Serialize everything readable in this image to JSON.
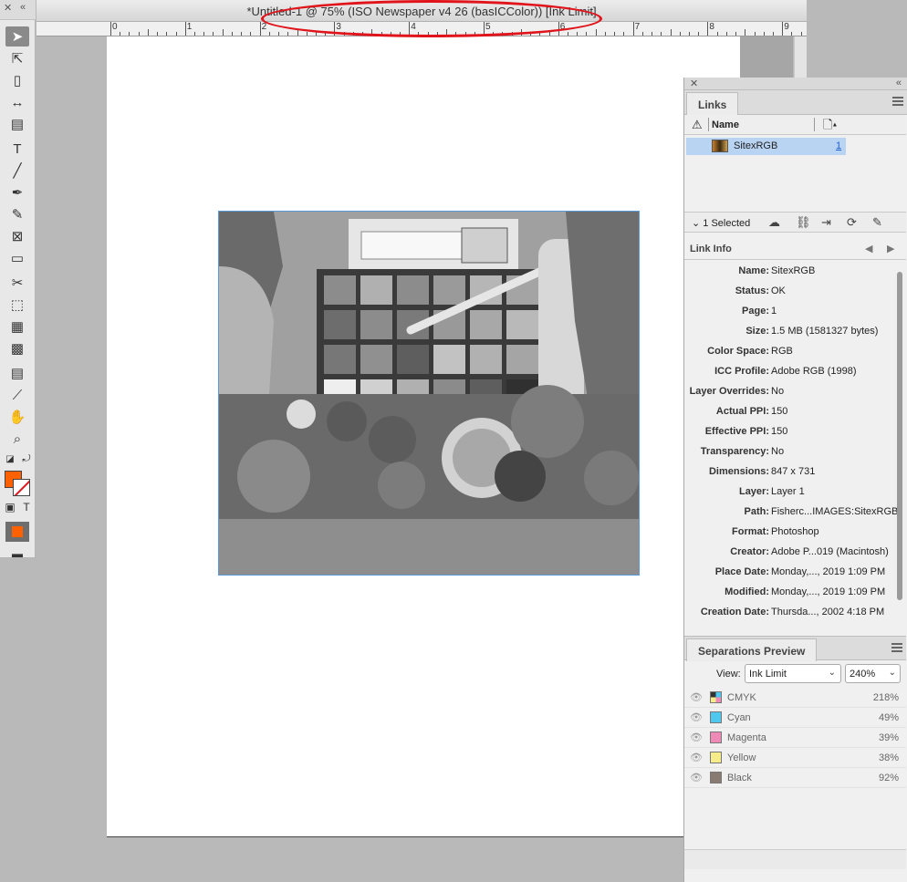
{
  "document": {
    "title": "*Untitled-1 @ 75% (ISO Newspaper v4 26 (basICColor)) [Ink Limit]",
    "ruler_numbers": [
      "0",
      "1",
      "2",
      "3",
      "4",
      "5",
      "6",
      "7",
      "8",
      "9"
    ]
  },
  "tools": {
    "items": [
      {
        "name": "selection-tool",
        "glyph": "➤"
      },
      {
        "name": "direct-selection-tool",
        "glyph": "⇱"
      },
      {
        "name": "page-tool",
        "glyph": "▯"
      },
      {
        "name": "gap-tool",
        "glyph": "↔"
      },
      {
        "name": "content-collector-tool",
        "glyph": "▤"
      },
      {
        "name": "type-tool",
        "glyph": "T"
      },
      {
        "name": "line-tool",
        "glyph": "╱"
      },
      {
        "name": "pen-tool",
        "glyph": "✒"
      },
      {
        "name": "pencil-tool",
        "glyph": "✎"
      },
      {
        "name": "rectangle-frame-tool",
        "glyph": "⊠"
      },
      {
        "name": "rectangle-tool",
        "glyph": "▭"
      },
      {
        "name": "scissors-tool",
        "glyph": "✂"
      },
      {
        "name": "free-transform-tool",
        "glyph": "⬚"
      },
      {
        "name": "gradient-swatch-tool",
        "glyph": "▦"
      },
      {
        "name": "gradient-feather-tool",
        "glyph": "▩"
      },
      {
        "name": "note-tool",
        "glyph": "▤"
      },
      {
        "name": "eyedropper-tool",
        "glyph": "⟋"
      },
      {
        "name": "hand-tool",
        "glyph": "✋"
      },
      {
        "name": "zoom-tool",
        "glyph": "⌕"
      }
    ],
    "colors": {
      "fill": "#ff6000",
      "stroke": "none"
    }
  },
  "links_panel": {
    "tab_label": "Links",
    "column_name": "Name",
    "items": [
      {
        "name": "SitexRGB",
        "page": "1"
      }
    ],
    "selected_text": "1 Selected"
  },
  "link_info": {
    "title": "Link Info",
    "rows": [
      {
        "label": "Name:",
        "value": "SitexRGB"
      },
      {
        "label": "Status:",
        "value": "OK"
      },
      {
        "label": "Page:",
        "value": "1"
      },
      {
        "label": "Size:",
        "value": "1.5 MB (1581327 bytes)"
      },
      {
        "label": "Color Space:",
        "value": "RGB"
      },
      {
        "label": "ICC Profile:",
        "value": "Adobe RGB (1998)"
      },
      {
        "label": "Layer Overrides:",
        "value": "No"
      },
      {
        "label": "Actual PPI:",
        "value": "150"
      },
      {
        "label": "Effective PPI:",
        "value": "150"
      },
      {
        "label": "Transparency:",
        "value": "No"
      },
      {
        "label": "Dimensions:",
        "value": "847 x 731"
      },
      {
        "label": "Layer:",
        "value": "Layer 1"
      },
      {
        "label": "Path:",
        "value": "Fisherc...IMAGES:SitexRGB"
      },
      {
        "label": "Format:",
        "value": "Photoshop"
      },
      {
        "label": "Creator:",
        "value": "Adobe P...019 (Macintosh)"
      },
      {
        "label": "Place Date:",
        "value": "Monday,..., 2019 1:09 PM"
      },
      {
        "label": "Modified:",
        "value": "Monday,..., 2019 1:09 PM"
      },
      {
        "label": "Creation Date:",
        "value": "Thursda..., 2002 4:18 PM"
      }
    ]
  },
  "separations": {
    "tab_label": "Separations Preview",
    "view_label": "View:",
    "view_value": "Ink Limit",
    "limit_value": "240%",
    "rows": [
      {
        "name": "CMYK",
        "pct": "218%",
        "color": "#cfcfcf"
      },
      {
        "name": "Cyan",
        "pct": "49%",
        "color": "#4ec8ee"
      },
      {
        "name": "Magenta",
        "pct": "39%",
        "color": "#ef8ab6"
      },
      {
        "name": "Yellow",
        "pct": "38%",
        "color": "#f7ec8a"
      },
      {
        "name": "Black",
        "pct": "92%",
        "color": "#8a7b72"
      }
    ]
  },
  "annotation_color": "#e0141a"
}
